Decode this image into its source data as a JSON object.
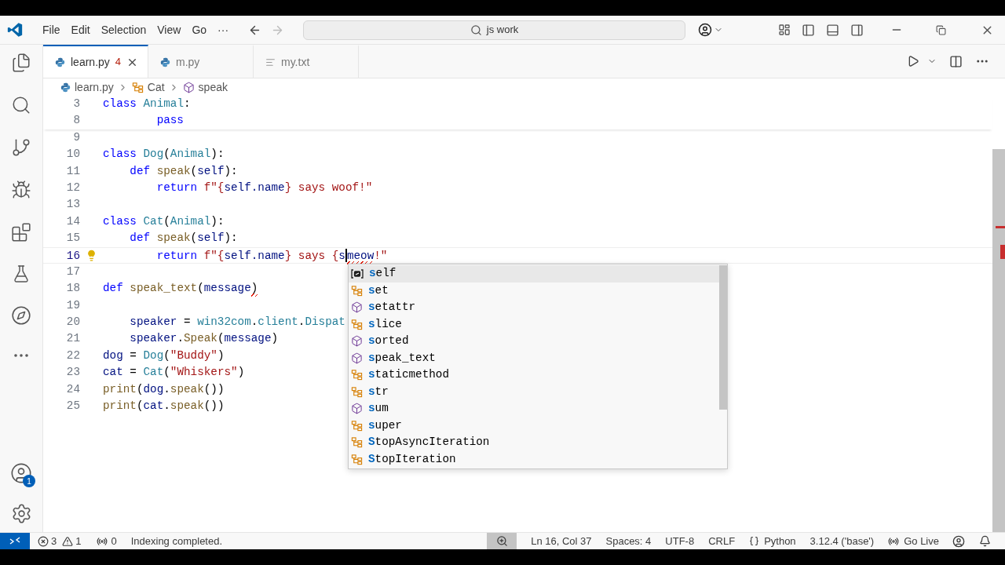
{
  "menu": [
    "File",
    "Edit",
    "Selection",
    "View",
    "Go",
    "···"
  ],
  "search": {
    "value": "js work"
  },
  "tabs": [
    {
      "label": "learn.py",
      "kind": "python",
      "problems": "4",
      "selected": true
    },
    {
      "label": "m.py",
      "kind": "python",
      "selected": false
    },
    {
      "label": "my.txt",
      "kind": "text",
      "selected": false
    }
  ],
  "breadcrumbs": [
    {
      "label": "learn.py",
      "kind": "python"
    },
    {
      "label": "Cat",
      "kind": "class"
    },
    {
      "label": "speak",
      "kind": "method"
    }
  ],
  "sticky_scroll": [
    {
      "number": "3",
      "current": false,
      "tokens": [
        {
          "t": "class ",
          "kind": "keyword"
        },
        {
          "t": "Animal",
          "kind": "type"
        },
        {
          "t": ":",
          "kind": "plain"
        }
      ]
    },
    {
      "number": "8",
      "current": false,
      "tokens": [
        {
          "t": "        pass",
          "kind": "keyword"
        }
      ]
    }
  ],
  "lines": [
    {
      "number": "9",
      "current": false
    },
    {
      "number": "10",
      "current": false,
      "tokens": [
        {
          "t": "class ",
          "kind": "keyword"
        },
        {
          "t": "Dog",
          "kind": "type"
        },
        {
          "t": "(",
          "kind": "plain"
        },
        {
          "t": "Animal",
          "kind": "type"
        },
        {
          "t": "):",
          "kind": "plain"
        }
      ]
    },
    {
      "number": "11",
      "current": false,
      "tokens": [
        {
          "t": "    def ",
          "kind": "keyword"
        },
        {
          "t": "speak",
          "kind": "func"
        },
        {
          "t": "(",
          "kind": "plain"
        },
        {
          "t": "self",
          "kind": "var"
        },
        {
          "t": "):",
          "kind": "plain"
        }
      ]
    },
    {
      "number": "12",
      "current": false,
      "tokens": [
        {
          "t": "        return ",
          "kind": "keyword"
        },
        {
          "t": "f\"{",
          "kind": "string"
        },
        {
          "t": "self",
          "kind": "var"
        },
        {
          "t": ".name",
          "kind": "var"
        },
        {
          "t": "} says woof!\"",
          "kind": "string"
        }
      ]
    },
    {
      "number": "13",
      "current": false
    },
    {
      "number": "14",
      "current": false,
      "tokens": [
        {
          "t": "class ",
          "kind": "keyword"
        },
        {
          "t": "Cat",
          "kind": "type"
        },
        {
          "t": "(",
          "kind": "plain"
        },
        {
          "t": "Animal",
          "kind": "type"
        },
        {
          "t": "):",
          "kind": "plain"
        }
      ]
    },
    {
      "number": "15",
      "current": false,
      "tokens": [
        {
          "t": "    def ",
          "kind": "keyword"
        },
        {
          "t": "speak",
          "kind": "func"
        },
        {
          "t": "(",
          "kind": "plain"
        },
        {
          "t": "self",
          "kind": "var"
        },
        {
          "t": "):",
          "kind": "plain"
        }
      ]
    },
    {
      "number": "16",
      "current": true,
      "lightbulb": true,
      "tokens": [
        {
          "t": "        return ",
          "kind": "keyword"
        },
        {
          "t": "f\"{",
          "kind": "string"
        },
        {
          "t": "self",
          "kind": "var"
        },
        {
          "t": ".name",
          "kind": "var"
        },
        {
          "t": "} says {",
          "kind": "string"
        },
        {
          "t": "s",
          "kind": "var",
          "cursor": true
        },
        {
          "t": "meow",
          "kind": "var",
          "error": true
        },
        {
          "t": "!\"",
          "kind": "string"
        }
      ]
    },
    {
      "number": "17",
      "current": false
    },
    {
      "number": "18",
      "current": false,
      "tokens": [
        {
          "t": "def ",
          "kind": "keyword"
        },
        {
          "t": "speak_text",
          "kind": "func"
        },
        {
          "t": "(",
          "kind": "plain"
        },
        {
          "t": "message",
          "kind": "var"
        },
        {
          "t": ")",
          "kind": "plain",
          "error": true
        }
      ]
    },
    {
      "number": "19",
      "current": false
    },
    {
      "number": "20",
      "current": false,
      "tokens": [
        {
          "t": "    speaker",
          "kind": "var"
        },
        {
          "t": " = ",
          "kind": "plain"
        },
        {
          "t": "win32com",
          "kind": "type"
        },
        {
          "t": ".",
          "kind": "plain"
        },
        {
          "t": "client",
          "kind": "type"
        },
        {
          "t": ".",
          "kind": "plain"
        },
        {
          "t": "Dispat",
          "kind": "type"
        }
      ]
    },
    {
      "number": "21",
      "current": false,
      "tokens": [
        {
          "t": "    speaker",
          "kind": "var"
        },
        {
          "t": ".",
          "kind": "plain"
        },
        {
          "t": "Speak",
          "kind": "func"
        },
        {
          "t": "(",
          "kind": "plain"
        },
        {
          "t": "message",
          "kind": "var"
        },
        {
          "t": ")",
          "kind": "plain"
        }
      ]
    },
    {
      "number": "22",
      "current": false,
      "tokens": [
        {
          "t": "dog",
          "kind": "var"
        },
        {
          "t": " = ",
          "kind": "plain"
        },
        {
          "t": "Dog",
          "kind": "type"
        },
        {
          "t": "(",
          "kind": "plain"
        },
        {
          "t": "\"Buddy\"",
          "kind": "string"
        },
        {
          "t": ")",
          "kind": "plain"
        }
      ]
    },
    {
      "number": "23",
      "current": false,
      "tokens": [
        {
          "t": "cat",
          "kind": "var"
        },
        {
          "t": " = ",
          "kind": "plain"
        },
        {
          "t": "Cat",
          "kind": "type"
        },
        {
          "t": "(",
          "kind": "plain"
        },
        {
          "t": "\"Whiskers\"",
          "kind": "string"
        },
        {
          "t": ")",
          "kind": "plain"
        }
      ]
    },
    {
      "number": "24",
      "current": false,
      "tokens": [
        {
          "t": "print",
          "kind": "func"
        },
        {
          "t": "(",
          "kind": "plain"
        },
        {
          "t": "dog",
          "kind": "var"
        },
        {
          "t": ".",
          "kind": "plain"
        },
        {
          "t": "speak",
          "kind": "func"
        },
        {
          "t": "())",
          "kind": "plain"
        }
      ]
    },
    {
      "number": "25",
      "current": false,
      "tokens": [
        {
          "t": "print",
          "kind": "func"
        },
        {
          "t": "(",
          "kind": "plain"
        },
        {
          "t": "cat",
          "kind": "var"
        },
        {
          "t": ".",
          "kind": "plain"
        },
        {
          "t": "speak",
          "kind": "func"
        },
        {
          "t": "())",
          "kind": "plain"
        }
      ]
    }
  ],
  "suggestions": [
    {
      "match": "s",
      "rest": "elf",
      "kind": "variable",
      "selected": true
    },
    {
      "match": "s",
      "rest": "et",
      "kind": "class",
      "selected": false
    },
    {
      "match": "s",
      "rest": "etattr",
      "kind": "function",
      "selected": false
    },
    {
      "match": "s",
      "rest": "lice",
      "kind": "class",
      "selected": false
    },
    {
      "match": "s",
      "rest": "orted",
      "kind": "function",
      "selected": false
    },
    {
      "match": "s",
      "rest": "peak_text",
      "kind": "function",
      "selected": false
    },
    {
      "match": "s",
      "rest": "taticmethod",
      "kind": "class",
      "selected": false
    },
    {
      "match": "s",
      "rest": "tr",
      "kind": "class",
      "selected": false
    },
    {
      "match": "s",
      "rest": "um",
      "kind": "function",
      "selected": false
    },
    {
      "match": "s",
      "rest": "uper",
      "kind": "class",
      "selected": false
    },
    {
      "match": "S",
      "rest": "topAsyncIteration",
      "kind": "class",
      "selected": false
    },
    {
      "match": "S",
      "rest": "topIteration",
      "kind": "class",
      "selected": false
    }
  ],
  "accounts_badge": "1",
  "status": {
    "errors": "3",
    "warnings": "1",
    "ports": "0",
    "message": "Indexing completed.",
    "right": [
      {
        "label": "Ln 16, Col 37",
        "kind": "text"
      },
      {
        "label": "Spaces: 4",
        "kind": "text"
      },
      {
        "label": "UTF-8",
        "kind": "text"
      },
      {
        "label": "CRLF",
        "kind": "text"
      },
      {
        "label": "Python",
        "kind": "language"
      },
      {
        "label": "3.12.4 ('base')",
        "kind": "text"
      },
      {
        "label": "Go Live",
        "kind": "live"
      }
    ]
  }
}
